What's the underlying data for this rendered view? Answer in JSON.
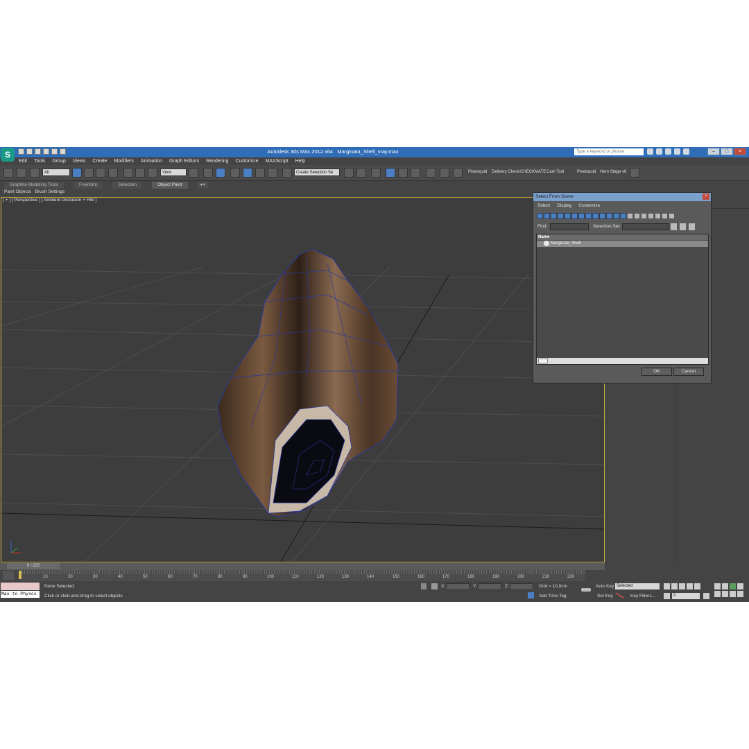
{
  "title_bar": {
    "app_title": "Autodesk 3ds Max  2012 x64",
    "file_name": "Marginata_Shell_vray.max",
    "search_placeholder": "Type a keyword or phrase"
  },
  "menu": [
    "Edit",
    "Tools",
    "Group",
    "Views",
    "Create",
    "Modifiers",
    "Animation",
    "Graph Editors",
    "Rendering",
    "Customize",
    "MAXScript",
    "Help"
  ],
  "toolbar": {
    "filter_value": "All",
    "coord_value": "View",
    "selection_set_value": "Create Selection Se",
    "plugins": [
      "Pixelsquid",
      "Delivery Check",
      "CHECKMATE",
      "Cam Tool",
      "Pixelsquid",
      "Hero Stage v6"
    ]
  },
  "ribbon": {
    "tabs": [
      "Graphite Modeling Tools",
      "Freeform",
      "Selection",
      "Object Paint"
    ],
    "active_tab": "Object Paint",
    "subtabs": [
      "Paint Objects",
      "Brush Settings"
    ]
  },
  "viewport": {
    "label": "[ + ] [ Perspective ] [ Ambient Occlusion + HW ]"
  },
  "timeline": {
    "frame_counter": "0 / 225",
    "ticks": [
      "10",
      "20",
      "30",
      "40",
      "50",
      "60",
      "70",
      "80",
      "90",
      "100",
      "110",
      "120",
      "130",
      "140",
      "150",
      "160",
      "170",
      "180",
      "190",
      "200",
      "210",
      "220"
    ]
  },
  "status_bar": {
    "maxscript": "Max to Physcs",
    "selection_status": "None Selected",
    "prompt": "Click or click-and-drag to select objects",
    "x_label": "X:",
    "y_label": "Y:",
    "z_label": "Z:",
    "grid": "Grid = 10,0cm",
    "add_time_tag": "Add Time Tag",
    "auto_key": "Auto Key",
    "auto_key_value": "Selected",
    "set_key": "Set Key",
    "key_filters": "Key Filters...",
    "frame_value": "0"
  },
  "dialog": {
    "title": "Select From Scene",
    "menu": [
      "Select",
      "Display",
      "Customize"
    ],
    "find_label": "Find:",
    "selection_set_label": "Selection Set:",
    "column_header": "Name",
    "items": [
      "Marginata_Shell"
    ],
    "ok_label": "OK",
    "cancel_label": "Cancel"
  }
}
